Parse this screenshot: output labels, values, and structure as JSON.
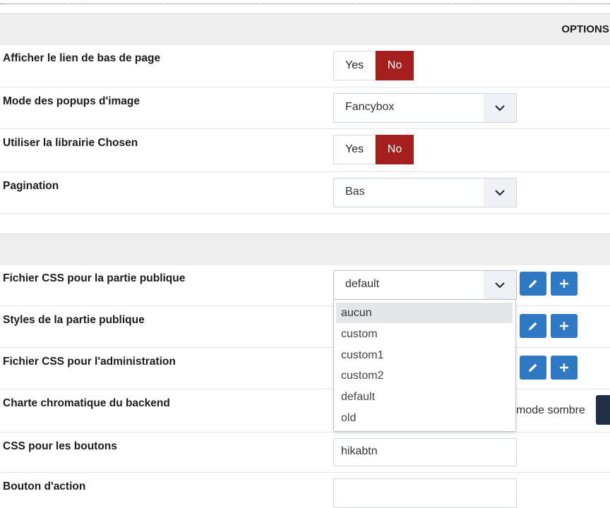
{
  "section1": {
    "title": "OPTIONS ("
  },
  "rows": {
    "footer_link": {
      "label": "Afficher le lien de bas de page",
      "yes": "Yes",
      "no": "No"
    },
    "popup_mode": {
      "label": "Mode des popups d'image",
      "value": "Fancybox"
    },
    "chosen": {
      "label": "Utiliser la librairie Chosen",
      "yes": "Yes",
      "no": "No"
    },
    "pagination": {
      "label": "Pagination",
      "value": "Bas"
    },
    "css_public": {
      "label": "Fichier CSS pour la partie publique",
      "value": "default"
    },
    "styles_public": {
      "label": "Styles de la partie publique"
    },
    "css_admin": {
      "label": "Fichier CSS pour l'administration"
    },
    "backend_theme": {
      "label": "Charte chromatique du backend",
      "dark_label": "mode sombre"
    },
    "button_css": {
      "label": "CSS pour les boutons",
      "value": "hikabtn"
    },
    "action_button": {
      "label": "Bouton d'action"
    }
  },
  "dropdown": {
    "options": [
      "aucun",
      "custom",
      "custom1",
      "custom2",
      "default",
      "old"
    ],
    "highlighted": "aucun"
  },
  "colors": {
    "no_active": "#a61f1f",
    "icon_button": "#2f78c4",
    "dark_theme": "#1f2f45"
  }
}
